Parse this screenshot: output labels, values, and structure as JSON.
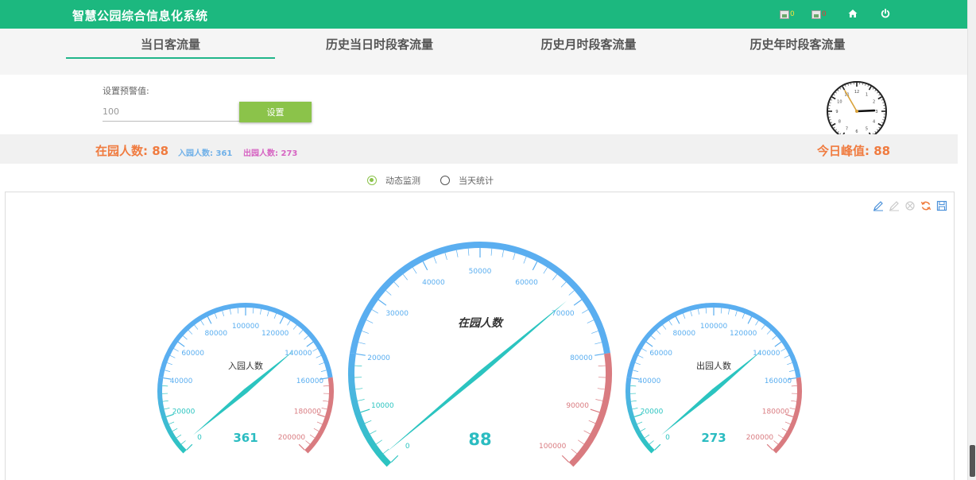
{
  "header": {
    "title": "智慧公园综合信息化系统",
    "badge_a": "0",
    "badge_b": "0",
    "badge_a_color": "#f5e33c",
    "badge_b_color": "#e53935"
  },
  "tabs": [
    {
      "label": "当日客流量"
    },
    {
      "label": "历史当日时段客流量"
    },
    {
      "label": "历史月时段客流量"
    },
    {
      "label": "历史年时段客流量"
    }
  ],
  "warning": {
    "label": "设置预警值:",
    "value": "100",
    "button": "设置"
  },
  "clock": {
    "hour": 2,
    "minute": 55
  },
  "stats": {
    "in_park_label": "在园人数:",
    "in_park_value": "88",
    "entered_label": "入园人数:",
    "entered_value": "361",
    "exited_label": "出园人数:",
    "exited_value": "273",
    "peak_label": "今日峰值:",
    "peak_value": "88"
  },
  "modes": [
    {
      "label": "动态监测",
      "checked": true
    },
    {
      "label": "当天统计",
      "checked": false
    }
  ],
  "toolbox": [
    "pen-icon",
    "pen-disabled-icon",
    "reset-icon",
    "refresh-icon",
    "save-icon"
  ],
  "colors": {
    "gauge_low": "#2bc4c0",
    "gauge_mid": "#5aaef0",
    "gauge_high": "#d97b80",
    "accent_green": "#1cb87f"
  },
  "gauges": [
    {
      "id": "entered",
      "name": "入园人数",
      "value": 361,
      "display": "361",
      "min": 0,
      "max": 200000,
      "ticks": [
        "0",
        "20000",
        "40000",
        "60000",
        "80000",
        "100000",
        "120000",
        "140000",
        "160000",
        "180000",
        "200000"
      ]
    },
    {
      "id": "inpark",
      "name": "在园人数",
      "value": 88,
      "display": "88",
      "min": 0,
      "max": 100000,
      "ticks": [
        "0",
        "10000",
        "20000",
        "30000",
        "40000",
        "50000",
        "60000",
        "70000",
        "80000",
        "90000",
        "100000"
      ]
    },
    {
      "id": "exited",
      "name": "出园人数",
      "value": 273,
      "display": "273",
      "min": 0,
      "max": 200000,
      "ticks": [
        "0",
        "20000",
        "40000",
        "60000",
        "80000",
        "100000",
        "120000",
        "140000",
        "160000",
        "180000",
        "200000"
      ]
    }
  ]
}
